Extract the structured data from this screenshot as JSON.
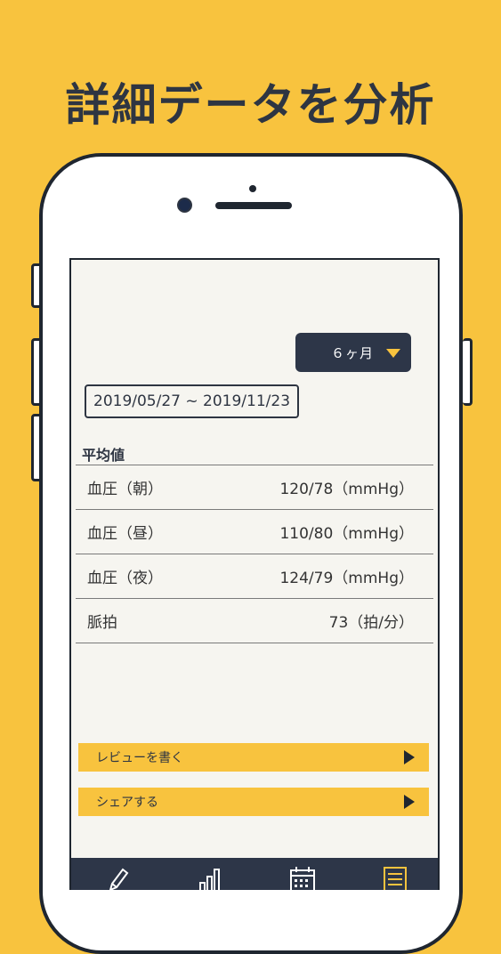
{
  "headline": "詳細データを分析",
  "period_select": {
    "value": "６ヶ月"
  },
  "date_range": "2019/05/27 ~ 2019/11/23",
  "section_title": "平均値",
  "averages": [
    {
      "label": "血圧（朝）",
      "value": "120/78（mmHg）"
    },
    {
      "label": "血圧（昼）",
      "value": "110/80（mmHg）"
    },
    {
      "label": "血圧（夜）",
      "value": "124/79（mmHg）"
    },
    {
      "label": "脈拍",
      "value": "73（拍/分）"
    }
  ],
  "actions": {
    "review": "レビューを書く",
    "share": "シェアする"
  },
  "tabs": [
    {
      "icon": "pencil-icon"
    },
    {
      "icon": "bar-chart-icon"
    },
    {
      "icon": "calendar-icon"
    },
    {
      "icon": "notes-icon"
    }
  ],
  "colors": {
    "background": "#f8c33e",
    "navy": "#2d3648",
    "screen": "#f6f5f0"
  }
}
